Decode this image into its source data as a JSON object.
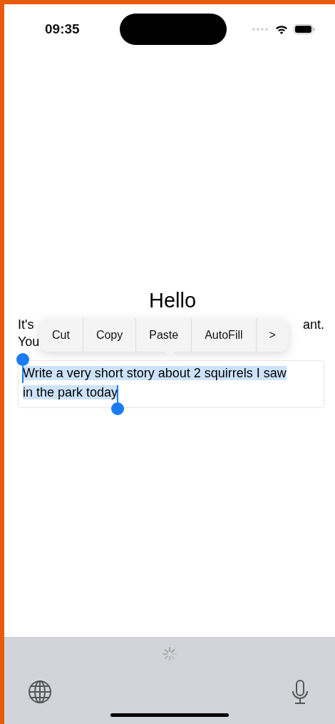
{
  "status_bar": {
    "time": "09:35"
  },
  "title": "Hello",
  "intro": {
    "line_1_start": "It's",
    "line_1_end": "ant.",
    "line_2_start": "You"
  },
  "context_menu": {
    "items": [
      {
        "label": "Cut"
      },
      {
        "label": "Copy"
      },
      {
        "label": "Paste"
      },
      {
        "label": "AutoFill"
      },
      {
        "label": ">"
      }
    ]
  },
  "prompt_field": {
    "value": "Write a very short story about 2 squirrels I saw in the park today",
    "selected": true
  }
}
